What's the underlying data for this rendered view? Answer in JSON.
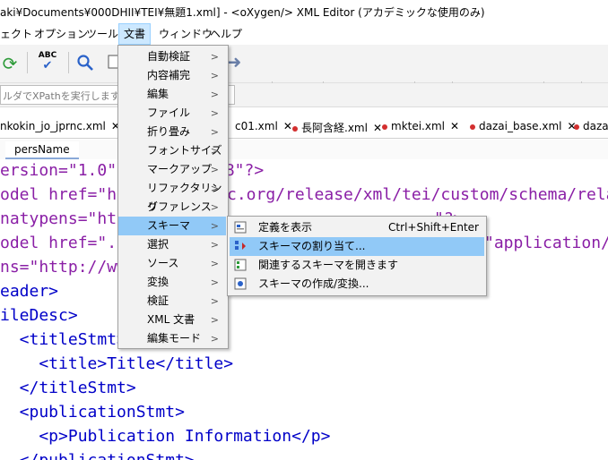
{
  "window": {
    "title": "aki¥Documents¥000DHII¥TEI¥無題1.xml] - <oXygen/> XML Editor (アカデミックな使用のみ)"
  },
  "menubar": {
    "items": [
      {
        "label": "ェクト"
      },
      {
        "label": "オプション"
      },
      {
        "label": "ツール"
      },
      {
        "label": "文書"
      },
      {
        "label": "ウィンドウ"
      },
      {
        "label": "ヘルプ"
      }
    ]
  },
  "toolbar": {
    "icons": [
      "refresh-icon",
      "spellcheck-icon",
      "search-icon",
      "copy-icon",
      "forward-arrow-icon",
      "xpath-icon",
      "gear-icon",
      "validate-icon",
      "dropdown-icon",
      "run-icon",
      "wrench-icon",
      "debug-run-icon",
      "format-icon",
      "tree-icon",
      "pin-icon",
      "pin-green-icon",
      "edit-icon",
      "pin-small-icon"
    ],
    "spellcheck_text": "ABC"
  },
  "xpath": {
    "placeholder": "ルダでXPathを実行します"
  },
  "tabs": [
    {
      "label": "nkokin_jo_jprnc.xml",
      "close": "✕",
      "modified": false
    },
    {
      "label": "c01.xml",
      "close": "✕",
      "modified": false
    },
    {
      "label": "長阿含経.xml",
      "close": "✕",
      "modified": true
    },
    {
      "label": "mktei.xml",
      "close": "✕",
      "modified": true
    },
    {
      "label": "dazai_base.xml",
      "close": "✕",
      "modified": true
    },
    {
      "label": "dazai_",
      "close": "",
      "modified": true
    }
  ],
  "breadcrumb": {
    "label": "persName"
  },
  "editor": {
    "lines": [
      "ersion=\"1.0\" e",
      "odel href=\"htt",
      "natypens=\"http",
      "odel href=\"../",
      "ns=\"http://www",
      "eader>",
      "ileDesc>",
      "  <titleStmt>",
      "    <title>Title</title>",
      "  </titleStmt>",
      "  <publicationStmt>",
      "    <p>Publication Information</p>",
      "  </publicationStmt>"
    ],
    "right_fragments": [
      {
        "line": 0,
        "text": "-8\"?>"
      },
      {
        "line": 1,
        "text": "c.org/release/xml/tei/custom/schema/relaxng"
      },
      {
        "line": 2,
        "text": "\"?>"
      },
      {
        "line": 3,
        "text": "\"application/r"
      }
    ]
  },
  "document_menu": {
    "items": [
      {
        "label": "自動検証",
        "submenu": true
      },
      {
        "label": "内容補完",
        "submenu": true
      },
      {
        "label": "編集",
        "submenu": true
      },
      {
        "label": "ファイル",
        "submenu": true
      },
      {
        "label": "折り畳み",
        "submenu": true
      },
      {
        "label": "フォントサイズ",
        "submenu": true
      },
      {
        "label": "マークアップ",
        "submenu": true
      },
      {
        "label": "リファクタリング",
        "submenu": true
      },
      {
        "label": "リファレンス",
        "submenu": true
      },
      {
        "label": "スキーマ",
        "submenu": true,
        "highlighted": true
      },
      {
        "label": "選択",
        "submenu": true
      },
      {
        "label": "ソース",
        "submenu": true
      },
      {
        "label": "変換",
        "submenu": true
      },
      {
        "label": "検証",
        "submenu": true
      },
      {
        "label": "XML 文書",
        "submenu": true
      },
      {
        "label": "編集モード",
        "submenu": true
      }
    ]
  },
  "schema_submenu": {
    "items": [
      {
        "label": "定義を表示",
        "shortcut": "Ctrl+Shift+Enter",
        "icon": "definition-icon"
      },
      {
        "label": "スキーマの割り当て...",
        "shortcut": "",
        "icon": "assign-schema-icon",
        "highlighted": true
      },
      {
        "label": "関連するスキーマを開きます",
        "shortcut": "",
        "icon": "open-schema-icon"
      },
      {
        "label": "スキーマの作成/変換...",
        "shortcut": "",
        "icon": "convert-schema-icon"
      }
    ]
  },
  "colors": {
    "highlight": "#91c9f7",
    "menubar_active": "#cce8ff",
    "tag": "#0000c8",
    "processing_instruction": "#8a1fa6",
    "modified_dot": "#d32f2f"
  }
}
